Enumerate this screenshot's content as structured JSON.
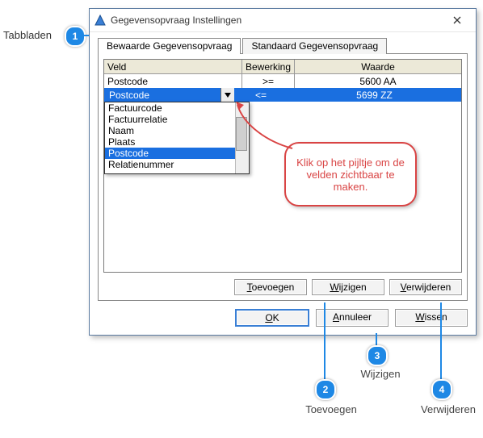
{
  "annotation_left_label": "Tabbladen",
  "dialog": {
    "title": "Gegevensopvraag Instellingen",
    "tabs": {
      "saved": "Bewaarde Gegevensopvraag",
      "standard": "Standaard Gegevensopvraag"
    },
    "grid": {
      "headers": {
        "veld": "Veld",
        "bewerking": "Bewerking",
        "waarde": "Waarde"
      },
      "row1": {
        "veld": "Postcode",
        "bew": ">=",
        "waarde": "5600 AA"
      },
      "row2": {
        "veld": "Postcode",
        "bew": "<=",
        "waarde": "5699 ZZ"
      }
    },
    "dropdown_items": {
      "i0": "Factuurcode",
      "i1": "Factuurrelatie",
      "i2": "Naam",
      "i3": "Plaats",
      "i4": "Postcode",
      "i5": "Relatienummer"
    },
    "buttons": {
      "toevoegen": "Toevoegen",
      "wijzigen": "Wijzigen",
      "verwijderen": "Verwijderen",
      "ok": "OK",
      "annuleer": "Annuleer",
      "wissen": "Wissen"
    }
  },
  "callout_text": "Klik op het pijltje om de velden zichtbaar te maken.",
  "annotations": {
    "n1": "1",
    "n2": "2",
    "n3": "3",
    "n4": "4",
    "c2": "Toevoegen",
    "c3": "Wijzigen",
    "c4": "Verwijderen"
  }
}
